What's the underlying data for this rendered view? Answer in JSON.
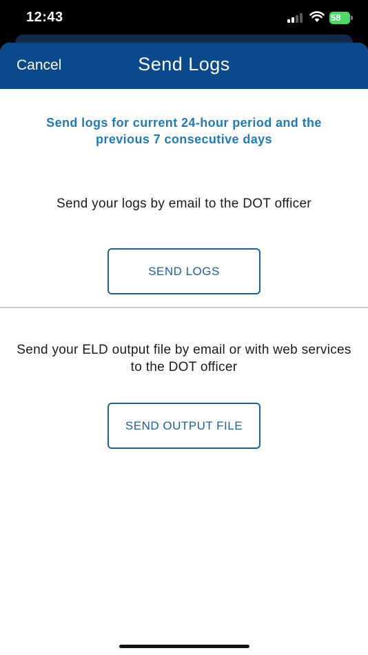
{
  "status_bar": {
    "time": "12:43",
    "battery_level": "58",
    "signal_icon": "cellular-signal-icon",
    "wifi_icon": "wifi-icon",
    "battery_icon": "battery-charging-icon",
    "battery_color": "#4cd964"
  },
  "nav": {
    "cancel_label": "Cancel",
    "title": "Send Logs",
    "background_color": "#0a4a8c"
  },
  "info": {
    "text": "Send logs for current 24-hour period and the previous 7 consecutive days",
    "color": "#1f7ab8"
  },
  "logs_section": {
    "description": "Send your logs by email to the DOT officer",
    "button_label": "SEND LOGS"
  },
  "output_section": {
    "description": "Send your ELD output file by email or with web services to the DOT officer",
    "button_label": "SEND OUTPUT FILE"
  }
}
